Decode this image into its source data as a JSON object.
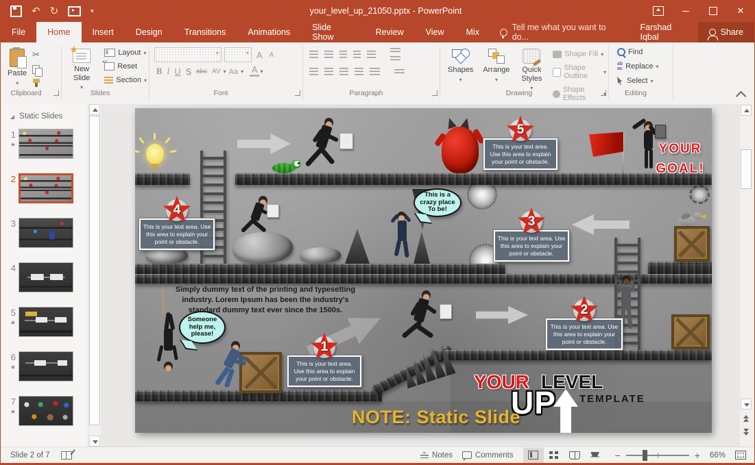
{
  "window": {
    "title": "your_level_up_21050.pptx - PowerPoint",
    "user": "Farshad Iqbal",
    "share": "Share"
  },
  "tabs": [
    "File",
    "Home",
    "Insert",
    "Design",
    "Transitions",
    "Animations",
    "Slide Show",
    "Review",
    "View",
    "Mix"
  ],
  "tell_me": "Tell me what you want to do...",
  "icons": {
    "caret": "▾",
    "undo": "↶",
    "redo": "↻",
    "cut": "✂",
    "star": "★",
    "expand_triangle": "◢"
  },
  "ribbon": {
    "clipboard": {
      "label": "Clipboard",
      "paste": "Paste"
    },
    "slides": {
      "label": "Slides",
      "new_slide": "New Slide",
      "layout": "Layout",
      "reset": "Reset",
      "section": "Section"
    },
    "font": {
      "label": "Font",
      "glyphs": {
        "bold": "B",
        "italic": "I",
        "underline": "U",
        "shadow": "S",
        "strike": "abc",
        "spacing": "AV",
        "case": "Aa",
        "color": "A",
        "grow": "A",
        "shrink": "A"
      }
    },
    "paragraph": {
      "label": "Paragraph"
    },
    "drawing": {
      "label": "Drawing",
      "shapes": "Shapes",
      "arrange": "Arrange",
      "quick_styles": "Quick Styles",
      "shape_fill": "Shape Fill",
      "shape_outline": "Shape Outline",
      "shape_effects": "Shape Effects"
    },
    "editing": {
      "label": "Editing",
      "find": "Find",
      "replace": "Replace",
      "select": "Select"
    }
  },
  "sidebar": {
    "section_title": "Static Slides",
    "slides": [
      {
        "num": "1",
        "starred": true,
        "selected": false
      },
      {
        "num": "2",
        "starred": false,
        "selected": true
      },
      {
        "num": "3",
        "starred": false,
        "selected": false
      },
      {
        "num": "4",
        "starred": false,
        "selected": false
      },
      {
        "num": "5",
        "starred": true,
        "selected": false
      },
      {
        "num": "6",
        "starred": true,
        "selected": false
      },
      {
        "num": "7",
        "starred": true,
        "selected": false
      }
    ]
  },
  "slide": {
    "obstacle_text": "This is your text area. Use this area to explain your point or obstacle.",
    "star_numbers": [
      "1",
      "2",
      "3",
      "4",
      "5"
    ],
    "bubble_crazy": "This is a\ncrazy place\nTo be!",
    "bubble_help": "Someone\nhelp me,\nplease!",
    "lorem": "Simply dummy text of the printing and typesetting industry. Lorem Ipsum has been the industry's standard dummy text ever since the 1500s.",
    "goal": "YOUR\nGOAL!",
    "logo": {
      "your": "YOUR",
      "level": "LEVEL",
      "up": "UP",
      "template": "TEMPLATE"
    },
    "note": "NOTE: Static Slide"
  },
  "statusbar": {
    "slide_indicator": "Slide 2 of 7",
    "notes": "Notes",
    "comments": "Comments",
    "zoom_level": "66%"
  },
  "colors": {
    "accent": "#b7472a",
    "star_red": "#d42a1e",
    "bubble_cyan": "#bdf3ec",
    "note_gold": "#e9b42a",
    "goal_red": "#e02020"
  }
}
